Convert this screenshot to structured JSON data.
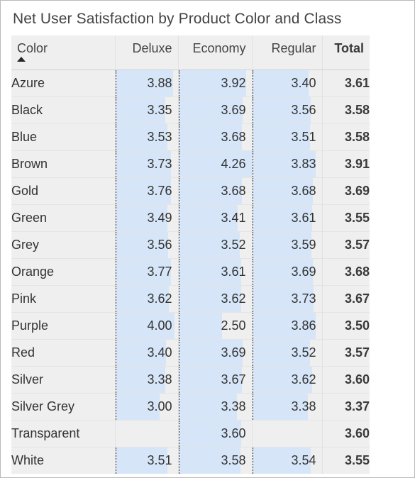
{
  "visual": {
    "title": "Net User Satisfaction by Product Color and Class",
    "sort_column": "Color",
    "sort_direction": "ascending",
    "sort_icon": "triangle-up-icon"
  },
  "colors": {
    "header_background": "#efefef",
    "row_background": "#efefef",
    "data_bar_fill": "#d6e6f8",
    "axis_line": "#2b2b2b",
    "text": "#333333",
    "title_text": "#444444",
    "grid_line": "#e2e2e2",
    "frame_border": "#b9b9b9"
  },
  "chart_data": {
    "type": "table",
    "title": "Net User Satisfaction by Product Color and Class",
    "xlabel": "",
    "ylabel": "",
    "columns": [
      "Color",
      "Deluxe",
      "Economy",
      "Regular",
      "Total"
    ],
    "row_key": "Color",
    "categories": [
      "Azure",
      "Black",
      "Blue",
      "Brown",
      "Gold",
      "Green",
      "Grey",
      "Orange",
      "Pink",
      "Purple",
      "Red",
      "Silver",
      "Silver Grey",
      "Transparent",
      "White"
    ],
    "series": [
      {
        "name": "Deluxe",
        "values": [
          3.88,
          3.35,
          3.53,
          3.73,
          3.76,
          3.49,
          3.56,
          3.77,
          3.62,
          4.0,
          3.4,
          3.38,
          3.0,
          null,
          3.51
        ]
      },
      {
        "name": "Economy",
        "values": [
          3.92,
          3.69,
          3.68,
          4.26,
          3.68,
          3.41,
          3.52,
          3.61,
          3.62,
          2.5,
          3.69,
          3.67,
          3.38,
          3.6,
          3.58
        ]
      },
      {
        "name": "Regular",
        "values": [
          3.4,
          3.56,
          3.51,
          3.83,
          3.68,
          3.61,
          3.59,
          3.69,
          3.73,
          3.86,
          3.52,
          3.62,
          3.38,
          null,
          3.54
        ]
      },
      {
        "name": "Total",
        "values": [
          3.61,
          3.58,
          3.58,
          3.91,
          3.69,
          3.55,
          3.57,
          3.68,
          3.67,
          3.5,
          3.57,
          3.6,
          3.37,
          3.6,
          3.55
        ]
      }
    ],
    "data_bars": {
      "applied_to": [
        "Deluxe",
        "Economy",
        "Regular"
      ],
      "min": 0,
      "max": 4.26,
      "fill": "#d6e6f8"
    },
    "grid": true,
    "legend": "none"
  },
  "table": {
    "headers": [
      {
        "label": "Color",
        "align": "left",
        "bold": false,
        "name": "column-header-color"
      },
      {
        "label": "Deluxe",
        "align": "right",
        "bold": false,
        "name": "column-header-deluxe"
      },
      {
        "label": "Economy",
        "align": "right",
        "bold": false,
        "name": "column-header-economy"
      },
      {
        "label": "Regular",
        "align": "right",
        "bold": false,
        "name": "column-header-regular"
      },
      {
        "label": "Total",
        "align": "right",
        "bold": true,
        "name": "column-header-total"
      }
    ],
    "rows": [
      {
        "color": "Azure",
        "deluxe": "3.88",
        "economy": "3.92",
        "regular": "3.40",
        "total": "3.61"
      },
      {
        "color": "Black",
        "deluxe": "3.35",
        "economy": "3.69",
        "regular": "3.56",
        "total": "3.58"
      },
      {
        "color": "Blue",
        "deluxe": "3.53",
        "economy": "3.68",
        "regular": "3.51",
        "total": "3.58"
      },
      {
        "color": "Brown",
        "deluxe": "3.73",
        "economy": "4.26",
        "regular": "3.83",
        "total": "3.91"
      },
      {
        "color": "Gold",
        "deluxe": "3.76",
        "economy": "3.68",
        "regular": "3.68",
        "total": "3.69"
      },
      {
        "color": "Green",
        "deluxe": "3.49",
        "economy": "3.41",
        "regular": "3.61",
        "total": "3.55"
      },
      {
        "color": "Grey",
        "deluxe": "3.56",
        "economy": "3.52",
        "regular": "3.59",
        "total": "3.57"
      },
      {
        "color": "Orange",
        "deluxe": "3.77",
        "economy": "3.61",
        "regular": "3.69",
        "total": "3.68"
      },
      {
        "color": "Pink",
        "deluxe": "3.62",
        "economy": "3.62",
        "regular": "3.73",
        "total": "3.67"
      },
      {
        "color": "Purple",
        "deluxe": "4.00",
        "economy": "2.50",
        "regular": "3.86",
        "total": "3.50"
      },
      {
        "color": "Red",
        "deluxe": "3.40",
        "economy": "3.69",
        "regular": "3.52",
        "total": "3.57"
      },
      {
        "color": "Silver",
        "deluxe": "3.38",
        "economy": "3.67",
        "regular": "3.62",
        "total": "3.60"
      },
      {
        "color": "Silver Grey",
        "deluxe": "3.00",
        "economy": "3.38",
        "regular": "3.38",
        "total": "3.37"
      },
      {
        "color": "Transparent",
        "deluxe": "",
        "economy": "3.60",
        "regular": "",
        "total": "3.60"
      },
      {
        "color": "White",
        "deluxe": "3.51",
        "economy": "3.58",
        "regular": "3.54",
        "total": "3.55"
      }
    ]
  }
}
